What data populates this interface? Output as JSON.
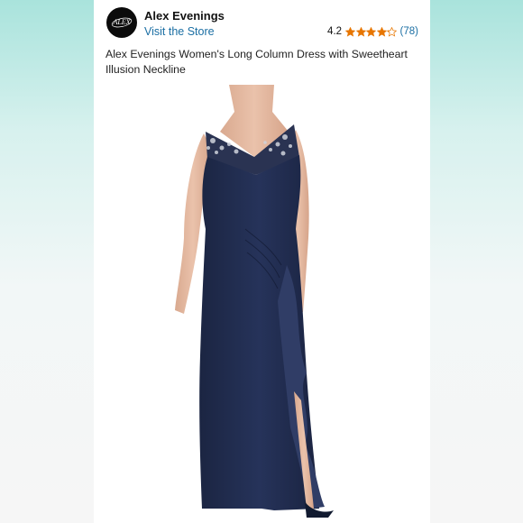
{
  "brand": {
    "name": "Alex Evenings",
    "link_label": "Visit the Store",
    "logo_text": "ALEX"
  },
  "rating": {
    "value": "4.2",
    "stars_filled": 4.2,
    "stars_total": 5,
    "count": "(78)",
    "star_color": "#e77600"
  },
  "product": {
    "title": "Alex Evenings Women's Long Column Dress with Sweetheart Illusion Neckline",
    "image_icon": "dress-photo",
    "dress_color": "#1f2a4a"
  },
  "colors": {
    "link": "#1a6ea3",
    "background_accent": "#bfe9e4"
  }
}
